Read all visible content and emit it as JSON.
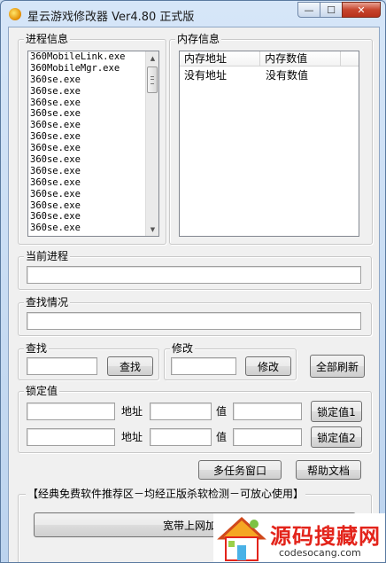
{
  "window": {
    "title": "星云游戏修改器 Ver4.80 正式版",
    "controls": {
      "minimize": "—",
      "maximize": "☐",
      "close": "✕"
    }
  },
  "process_group": {
    "label": "进程信息",
    "items": [
      "360MobileLink.exe",
      "360MobileMgr.exe",
      "360se.exe",
      "360se.exe",
      "360se.exe",
      "360se.exe",
      "360se.exe",
      "360se.exe",
      "360se.exe",
      "360se.exe",
      "360se.exe",
      "360se.exe",
      "360se.exe",
      "360se.exe",
      "360se.exe",
      "360se.exe"
    ]
  },
  "memory_group": {
    "label": "内存信息",
    "columns": [
      "内存地址",
      "内存数值"
    ],
    "rows": [
      [
        "没有地址",
        "没有数值"
      ]
    ]
  },
  "current_process": {
    "label": "当前进程",
    "value": ""
  },
  "search_status": {
    "label": "查找情况",
    "value": ""
  },
  "search": {
    "label": "查找",
    "value": "",
    "button": "查找"
  },
  "modify": {
    "label": "修改",
    "value": "",
    "button": "修改"
  },
  "refresh_all_button": "全部刷新",
  "lock_group": {
    "label": "锁定值",
    "address_label": "地址",
    "value_label": "值",
    "rows": [
      {
        "name": "",
        "address": "",
        "value": "",
        "button": "锁定值1"
      },
      {
        "name": "",
        "address": "",
        "value": "",
        "button": "锁定值2"
      }
    ]
  },
  "multitask_button": "多任务窗口",
  "help_button": "帮助文档",
  "ad_group": {
    "label": "【经典免费软件推荐区－均经正版杀软检测－可放心使用】",
    "button": "宽带上网加速"
  },
  "watermark": {
    "name": "源码搜藏网",
    "domain": "codesocang.com"
  },
  "colors": {
    "title_bg": "#c9dcf2",
    "client_bg": "#f0f0f0",
    "watermark_red": "#e3241b"
  }
}
